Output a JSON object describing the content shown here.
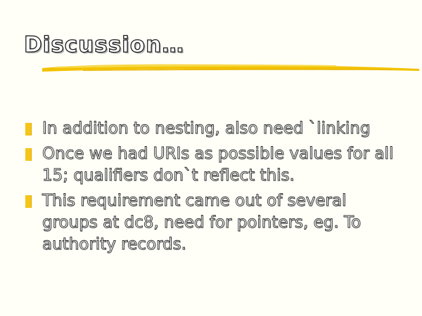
{
  "slide": {
    "title": "Discussion…",
    "accent_color": "#f5c518",
    "bullets": [
      {
        "text": "In addition to nesting, also need `linking"
      },
      {
        "text": "Once we had URIs as possible values for all 15; qualifiers don`t reflect this."
      },
      {
        "text": "This requirement came out of several groups at dc8, need for pointers, eg. To authority records."
      }
    ]
  }
}
